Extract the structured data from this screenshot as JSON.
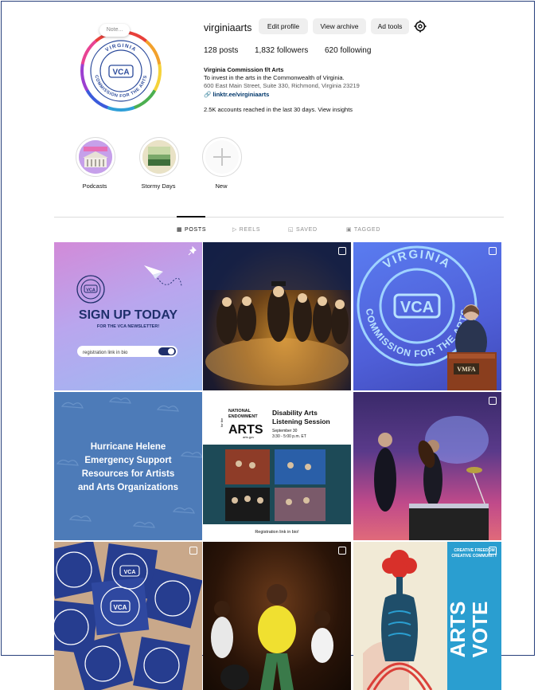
{
  "profile": {
    "username": "virginiaarts",
    "note": "Note...",
    "edit_profile": "Edit profile",
    "view_archive": "View archive",
    "ad_tools": "Ad tools",
    "posts": "128",
    "posts_label": "posts",
    "followers": "1,832",
    "followers_label": "followers",
    "following": "620",
    "following_label": "following",
    "bio_name": "Virginia Commission f/t Arts",
    "bio_line": "To invest in the arts in the Commonwealth of Virginia.",
    "bio_address": "600 East Main Street, Suite 330, Richmond, Virginia 23219",
    "bio_link": "linktr.ee/virginiaarts",
    "reach": "2.5K accounts reached in the last 30 days. View insights",
    "logo_text": {
      "top": "VIRGINIA",
      "center": "VCA",
      "bottom": "COMMISSION FOR THE ARTS"
    }
  },
  "highlights": [
    {
      "label": "Podcasts"
    },
    {
      "label": "Stormy Days"
    },
    {
      "label": "New"
    }
  ],
  "tabs": [
    {
      "label": "POSTS"
    },
    {
      "label": "REELS"
    },
    {
      "label": "SAVED"
    },
    {
      "label": "TAGGED"
    }
  ],
  "posts": {
    "signup": {
      "title": "SIGN UP TODAY",
      "subtitle": "FOR THE VCA NEWSLETTER!",
      "field": "registration link in bio",
      "logo": "VCA"
    },
    "stage": {
      "icon": "stacked-posts-icon"
    },
    "podium": {
      "top": "VIRGINIA",
      "center": "VCA",
      "bottom": "COMMISSION FOR THE ARTS",
      "sign": "VMFA"
    },
    "helene": {
      "lines": [
        "Hurricane Helene",
        "Emergency Support",
        "Resources for Artists",
        "and Arts Organizations"
      ]
    },
    "disability": {
      "nea_top": "NATIONAL",
      "nea_mid": "ENDOWMENT",
      "nea_for": "for the",
      "nea_arts": "ARTS",
      "nea_url": "arts.gov",
      "title_1": "Disability Arts",
      "title_2": "Listening Session",
      "date": "September 30",
      "time": "3:30 - 5:00 p.m. ET",
      "footer": "Registration link in bio!"
    },
    "musicians": {},
    "stickers": {
      "center": "VCA",
      "top": "VIRGINIA",
      "bottom": "COMMISSION FOR THE ARTS"
    },
    "dance": {},
    "vote": {
      "top_1": "CREATIVE FREEDOM",
      "top_2": "CREATIVE COMMUNITY",
      "word_1": "ARTS",
      "word_2": "VOTE"
    }
  }
}
